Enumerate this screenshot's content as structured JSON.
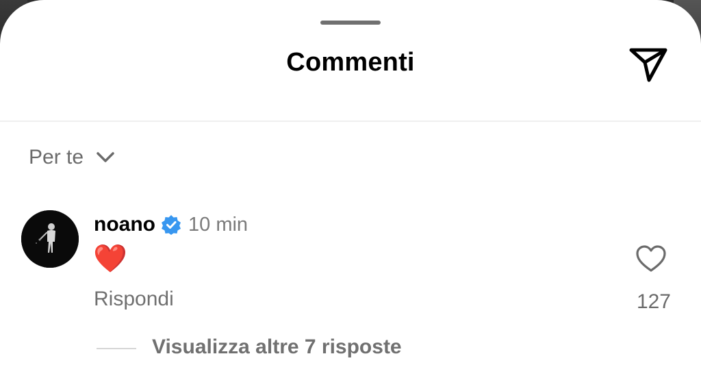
{
  "header": {
    "title": "Commenti",
    "icons": {
      "send": "paper-plane-icon"
    }
  },
  "sort": {
    "label": "Per te",
    "icon": "chevron-down-icon"
  },
  "comment": {
    "username": "noano",
    "verified": true,
    "time": "10 min",
    "text": "❤️",
    "reply_label": "Rispondi",
    "like_count": "127",
    "view_more_label": "Visualizza altre 7 risposte"
  },
  "colors": {
    "verified_blue": "#3897f0",
    "heart_red": "#e0245e",
    "secondary_text": "#707070"
  }
}
